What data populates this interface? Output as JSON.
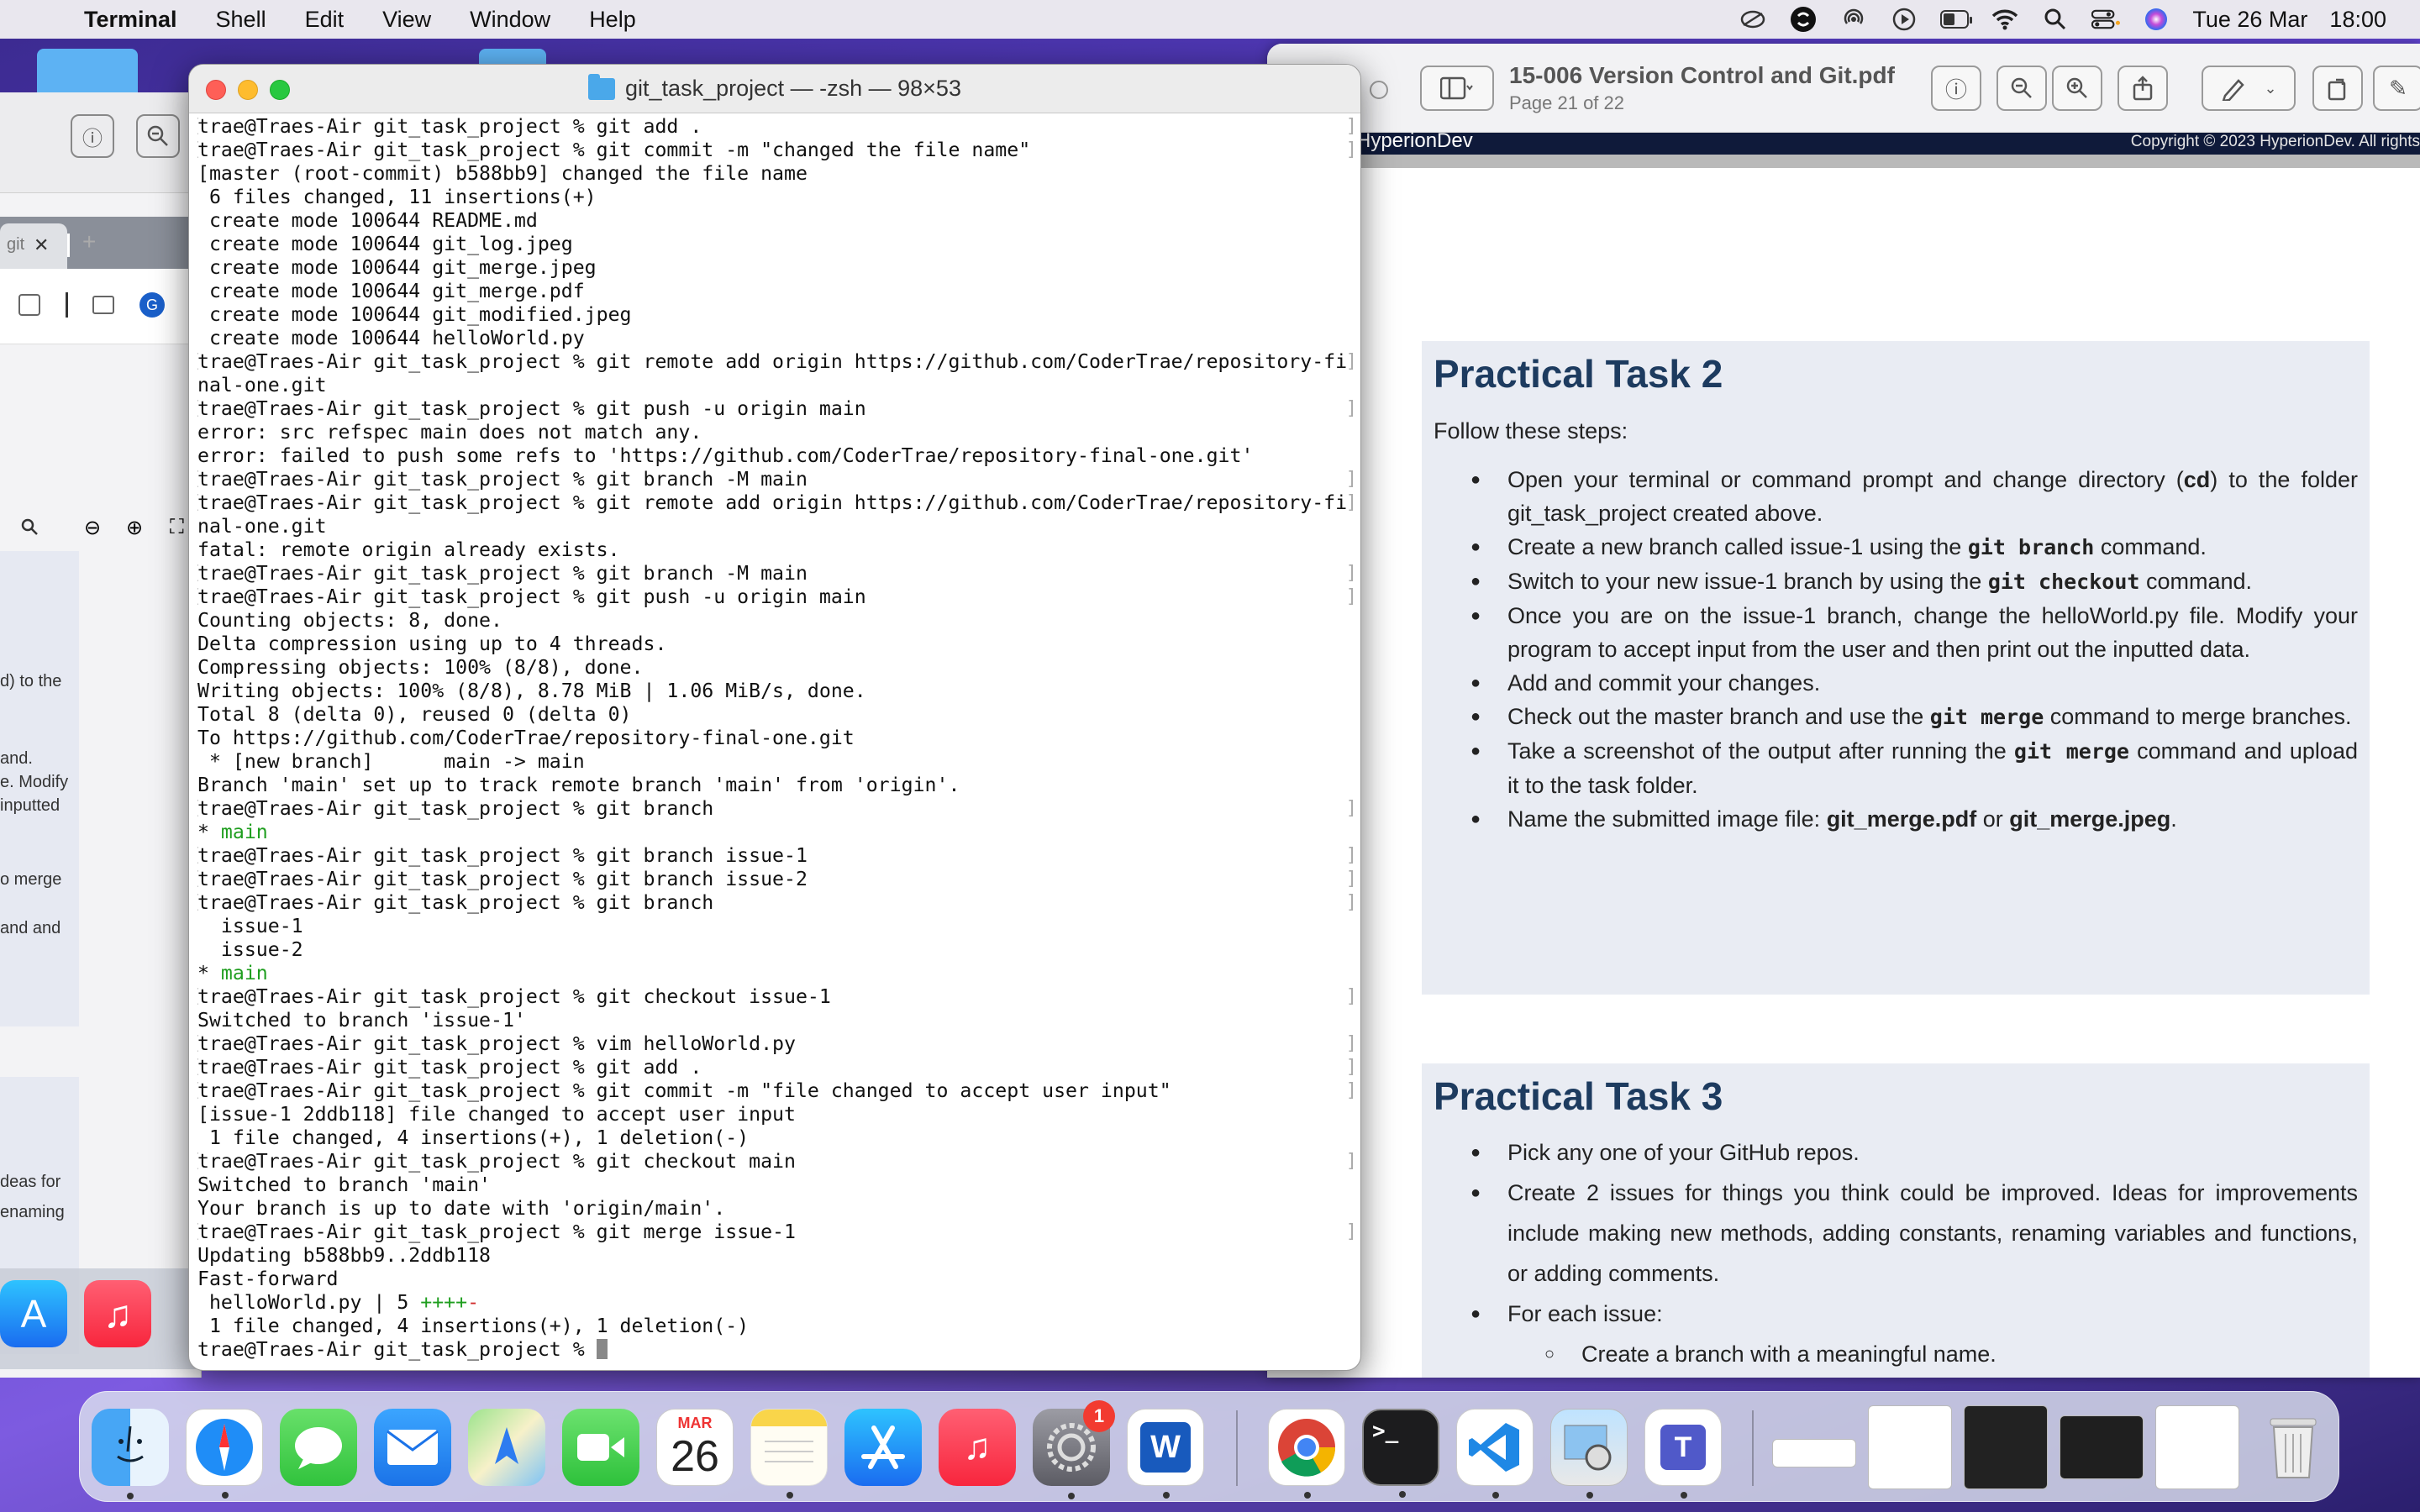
{
  "menubar": {
    "app_name": "Terminal",
    "items": [
      "Shell",
      "Edit",
      "View",
      "Window",
      "Help"
    ],
    "date": "Tue 26 Mar",
    "time": "18:00",
    "battery_level": 0.35
  },
  "terminal": {
    "title": "git_task_project — -zsh — 98×53",
    "lines": [
      {
        "text": "trae@Traes-Air git_task_project % git add .",
        "prompt": true
      },
      {
        "text": "trae@Traes-Air git_task_project % git commit -m \"changed the file name\"",
        "prompt": true
      },
      {
        "text": "[master (root-commit) b588bb9] changed the file name"
      },
      {
        "text": " 6 files changed, 11 insertions(+)"
      },
      {
        "text": " create mode 100644 README.md"
      },
      {
        "text": " create mode 100644 git_log.jpeg"
      },
      {
        "text": " create mode 100644 git_merge.jpeg"
      },
      {
        "text": " create mode 100644 git_merge.pdf"
      },
      {
        "text": " create mode 100644 git_modified.jpeg"
      },
      {
        "text": " create mode 100644 helloWorld.py"
      },
      {
        "text": "trae@Traes-Air git_task_project % git remote add origin https://github.com/CoderTrae/repository-fi",
        "prompt": true
      },
      {
        "text": "nal-one.git"
      },
      {
        "text": "trae@Traes-Air git_task_project % git push -u origin main",
        "prompt": true
      },
      {
        "text": "error: src refspec main does not match any."
      },
      {
        "text": "error: failed to push some refs to 'https://github.com/CoderTrae/repository-final-one.git'"
      },
      {
        "text": "trae@Traes-Air git_task_project % git branch -M main",
        "prompt": true
      },
      {
        "text": "trae@Traes-Air git_task_project % git remote add origin https://github.com/CoderTrae/repository-fi",
        "prompt": true
      },
      {
        "text": "nal-one.git"
      },
      {
        "text": "fatal: remote origin already exists."
      },
      {
        "text": "trae@Traes-Air git_task_project % git branch -M main",
        "prompt": true
      },
      {
        "text": "trae@Traes-Air git_task_project % git push -u origin main",
        "prompt": true
      },
      {
        "text": "Counting objects: 8, done."
      },
      {
        "text": "Delta compression using up to 4 threads."
      },
      {
        "text": "Compressing objects: 100% (8/8), done."
      },
      {
        "text": "Writing objects: 100% (8/8), 8.78 MiB | 1.06 MiB/s, done."
      },
      {
        "text": "Total 8 (delta 0), reused 0 (delta 0)"
      },
      {
        "text": "To https://github.com/CoderTrae/repository-final-one.git"
      },
      {
        "text": " * [new branch]      main -> main"
      },
      {
        "text": "Branch 'main' set up to track remote branch 'main' from 'origin'."
      },
      {
        "text": "trae@Traes-Air git_task_project % git branch",
        "prompt": true
      },
      {
        "text": "* ",
        "green": "main"
      },
      {
        "text": "trae@Traes-Air git_task_project % git branch issue-1",
        "prompt": true
      },
      {
        "text": "trae@Traes-Air git_task_project % git branch issue-2",
        "prompt": true
      },
      {
        "text": "trae@Traes-Air git_task_project % git branch",
        "prompt": true
      },
      {
        "text": "  issue-1"
      },
      {
        "text": "  issue-2"
      },
      {
        "text": "* ",
        "green": "main"
      },
      {
        "text": "trae@Traes-Air git_task_project % git checkout issue-1",
        "prompt": true
      },
      {
        "text": "Switched to branch 'issue-1'"
      },
      {
        "text": "trae@Traes-Air git_task_project % vim helloWorld.py",
        "prompt": true
      },
      {
        "text": "trae@Traes-Air git_task_project % git add .",
        "prompt": true
      },
      {
        "text": "trae@Traes-Air git_task_project % git commit -m \"file changed to accept user input\"",
        "prompt": true
      },
      {
        "text": "[issue-1 2ddb118] file changed to accept user input"
      },
      {
        "text": " 1 file changed, 4 insertions(+), 1 deletion(-)"
      },
      {
        "text": "trae@Traes-Air git_task_project % git checkout main",
        "prompt": true
      },
      {
        "text": "Switched to branch 'main'"
      },
      {
        "text": "Your branch is up to date with 'origin/main'."
      },
      {
        "text": "trae@Traes-Air git_task_project % git merge issue-1",
        "prompt": true
      },
      {
        "text": "Updating b588bb9..2ddb118"
      },
      {
        "text": "Fast-forward"
      },
      {
        "text": " helloWorld.py | 5 ",
        "green": "++++",
        "red": "-"
      },
      {
        "text": " 1 file changed, 4 insertions(+), 1 deletion(-)"
      },
      {
        "text": "trae@Traes-Air git_task_project % ",
        "cursor": true
      }
    ]
  },
  "preview": {
    "title": "15-006 Version Control and Git.pdf",
    "subtitle": "Page 21 of 22",
    "brand": "HyperionDev",
    "copyright": "Copyright © 2023 HyperionDev. All rights",
    "task2": {
      "title": "Practical Task 2",
      "intro": "Follow these steps:",
      "items": [
        [
          "Open your terminal or command prompt and change directory (",
          {
            "b": "cd"
          },
          ") to the folder git_task_project created above."
        ],
        [
          "Create a new branch called issue-1 using the ",
          {
            "c": "git branch"
          },
          " command."
        ],
        [
          "Switch to your new issue-1 branch by using the ",
          {
            "c": "git checkout"
          },
          " command."
        ],
        [
          "Once you are on the issue-1 branch, change the helloWorld.py file. Modify your program to accept input from the user and then print out the inputted data."
        ],
        [
          "Add and commit your changes."
        ],
        [
          "Check out the master branch and use the ",
          {
            "c": "git merge"
          },
          " command to merge branches."
        ],
        [
          "Take a screenshot of the output after running the ",
          {
            "c": "git merge"
          },
          " command and upload it to the task folder."
        ],
        [
          "Name the submitted image file: ",
          {
            "b": "git_merge.pdf"
          },
          " or ",
          {
            "b": "git_merge.jpeg"
          },
          "."
        ]
      ]
    },
    "task3": {
      "title": "Practical Task 3",
      "items": [
        "Pick any one of your GitHub repos.",
        "Create 2 issues for things you think could be improved. Ideas for improvements include making new methods, adding constants, renaming variables and functions, or adding comments.",
        "For each issue:"
      ],
      "subitem": "Create a branch with a meaningful name."
    }
  },
  "left_window": {
    "tab_label": "git",
    "avatar_letter": "G",
    "fragments": [
      "d) to the",
      "and.",
      "e. Modify",
      "inputted",
      "o merge",
      "and and",
      "deas  for",
      "enaming"
    ]
  },
  "dock": {
    "calendar_month": "MAR",
    "calendar_day": "26",
    "settings_badge": "1",
    "apps": [
      "Finder",
      "Safari",
      "Messages",
      "Mail",
      "Maps",
      "FaceTime",
      "Calendar",
      "Notes",
      "App Store",
      "Music",
      "System Settings",
      "Word",
      "Chrome",
      "Terminal",
      "VS Code",
      "Preview",
      "Teams"
    ]
  }
}
